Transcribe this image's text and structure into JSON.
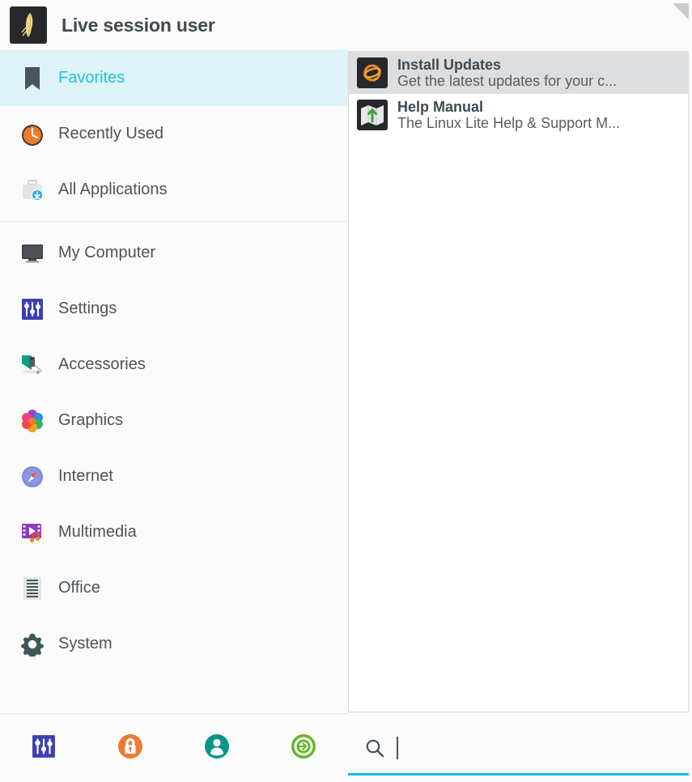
{
  "window": {
    "title": "Live session user",
    "avatar_icon": "user-avatar-feather-icon",
    "resize_grip_icon": "resize-grip-icon"
  },
  "theme": {
    "accent": "#1ec4e0",
    "selected_category_bg": "#ddf3f7",
    "selected_app_bg": "#dcdedf",
    "text": "#4a545c",
    "title_text": "#3f4a52",
    "panel_bg": "#ffffff",
    "window_bg": "#fbfbfb",
    "search_underline": "#16c0de"
  },
  "sidebar": {
    "groups": [
      {
        "items": [
          {
            "label": "Favorites",
            "icon": "bookmark-icon",
            "selected": true
          },
          {
            "label": "Recently Used",
            "icon": "clock-icon",
            "selected": false
          },
          {
            "label": "All Applications",
            "icon": "briefcase-download-icon",
            "selected": false
          }
        ]
      },
      {
        "items": [
          {
            "label": "My Computer",
            "icon": "monitor-icon",
            "selected": false
          },
          {
            "label": "Settings",
            "icon": "sliders-icon",
            "selected": false
          },
          {
            "label": "Accessories",
            "icon": "accessories-icon",
            "selected": false
          },
          {
            "label": "Graphics",
            "icon": "pinwheel-icon",
            "selected": false
          },
          {
            "label": "Internet",
            "icon": "compass-icon",
            "selected": false
          },
          {
            "label": "Multimedia",
            "icon": "media-play-icon",
            "selected": false
          },
          {
            "label": "Office",
            "icon": "document-icon",
            "selected": false
          },
          {
            "label": "System",
            "icon": "gear-icon",
            "selected": false
          }
        ]
      }
    ]
  },
  "toolbar": {
    "buttons": [
      {
        "name": "settings-manager-button",
        "icon": "sliders-icon",
        "color": "#4040b8"
      },
      {
        "name": "lock-screen-button",
        "icon": "lock-icon",
        "color": "#ec7a35"
      },
      {
        "name": "switch-user-button",
        "icon": "user-icon",
        "color": "#06948b"
      },
      {
        "name": "log-out-button",
        "icon": "power-exit-icon",
        "color": "#64b82c"
      }
    ]
  },
  "applications": {
    "items": [
      {
        "name": "Install Updates",
        "description": "Get the latest updates for your c...",
        "icon": "update-swirl-icon",
        "selected": true
      },
      {
        "name": "Help Manual",
        "description": "The Linux Lite Help & Support M...",
        "icon": "map-help-icon",
        "selected": false
      }
    ]
  },
  "search": {
    "icon": "search-icon",
    "value": "",
    "placeholder": "",
    "focused": true
  }
}
